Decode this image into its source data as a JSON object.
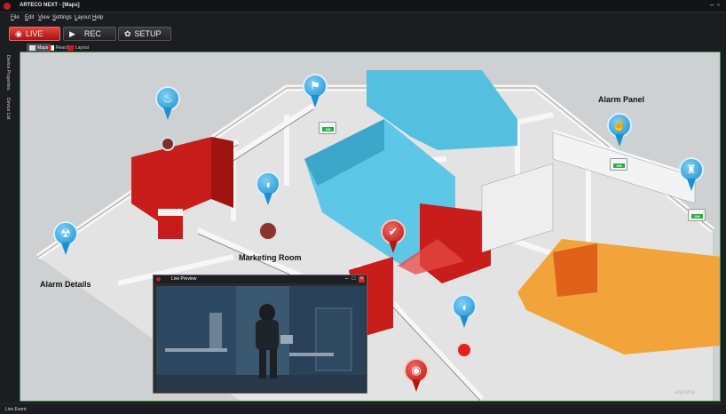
{
  "window": {
    "title": "ARTECO NEXT - [Maps]",
    "minimize_glyph": "–",
    "restore_glyph": "▫"
  },
  "menu": [
    {
      "label": "File",
      "key": "F",
      "rest": "ile"
    },
    {
      "label": "Edit",
      "key": "E",
      "rest": "dit"
    },
    {
      "label": "View",
      "key": "V",
      "rest": "iew"
    },
    {
      "label": "Settings",
      "key": "S",
      "rest": "ettings"
    },
    {
      "label": "Layout",
      "key": "L",
      "rest": "ayout"
    },
    {
      "label": "Help",
      "key": "H",
      "rest": "elp"
    }
  ],
  "toolbar": {
    "live_label": "LIVE",
    "rec_label": "REC",
    "setup_label": "SETUP"
  },
  "tabs": [
    {
      "label": "Maps",
      "active": true
    },
    {
      "label": "Reach",
      "active": false
    },
    {
      "label": "Layout",
      "active": false
    }
  ],
  "left_panel": {
    "device_properties": "Device Properties",
    "device_list": "Device List"
  },
  "map": {
    "labels": {
      "alarm_panel": "Alarm Panel",
      "alarm_details": "Alarm Details",
      "marketing_room": "Marketing Room"
    },
    "badge_on": "ON",
    "watermark": "aryeshia",
    "colors": {
      "red_room": "#c81e1b",
      "blue_room": "#55bfe0",
      "orange_room": "#f0a43a",
      "pin_blue": "#1b8fcf",
      "pin_red": "#b5160f",
      "on_green": "#22b142"
    }
  },
  "preview": {
    "title": "Live Preview"
  },
  "status": {
    "text": "Live Event"
  }
}
